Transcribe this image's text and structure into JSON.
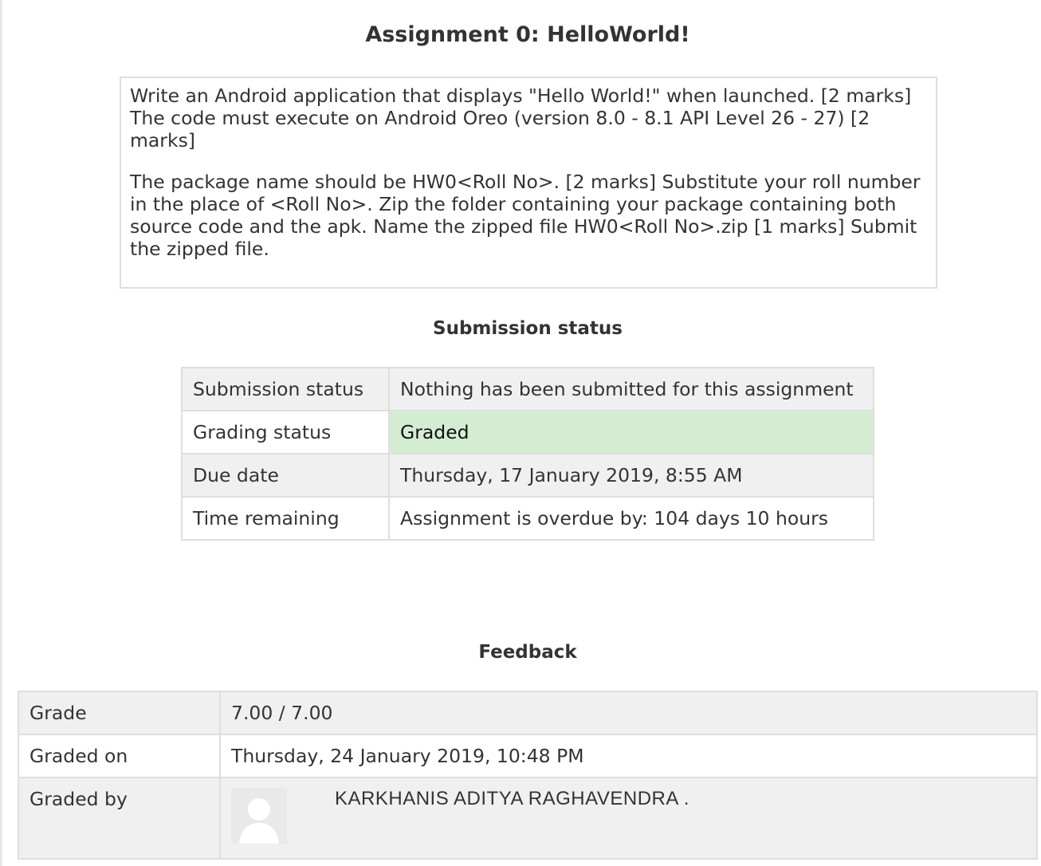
{
  "page": {
    "title": "Assignment 0: HelloWorld!"
  },
  "intro": {
    "paragraph1": "Write an Android application that displays \"Hello World!\" when launched. [2 marks] The code must execute on Android Oreo (version 8.0 - 8.1 API Level 26 - 27) [2 marks]",
    "paragraph2": "The package name should be HW0<Roll No>. [2 marks] Substitute your roll number in the place of <Roll No>. Zip the folder containing your package containing both source code and the apk. Name the zipped file HW0<Roll No>.zip [1 marks] Submit the zipped file."
  },
  "submission": {
    "heading": "Submission status",
    "rows": [
      {
        "label": "Submission status",
        "value": "Nothing has been submitted for this assignment"
      },
      {
        "label": "Grading status",
        "value": "Graded"
      },
      {
        "label": "Due date",
        "value": "Thursday, 17 January 2019, 8:55 AM"
      },
      {
        "label": "Time remaining",
        "value": "Assignment is overdue by: 104 days 10 hours"
      }
    ]
  },
  "feedback": {
    "heading": "Feedback",
    "rows": [
      {
        "label": "Grade",
        "value": "7.00 / 7.00"
      },
      {
        "label": "Graded on",
        "value": "Thursday, 24 January 2019, 10:48 PM"
      },
      {
        "label": "Graded by",
        "value": "KARKHANIS ADITYA RAGHAVENDRA ."
      }
    ]
  },
  "colors": {
    "graded_bg": "#d4edd2",
    "overdue_text": "#e0271b",
    "row_bg": "#f0f0f0",
    "border": "#dedede"
  },
  "icons": {
    "grader_avatar": "default-user-avatar-icon"
  }
}
